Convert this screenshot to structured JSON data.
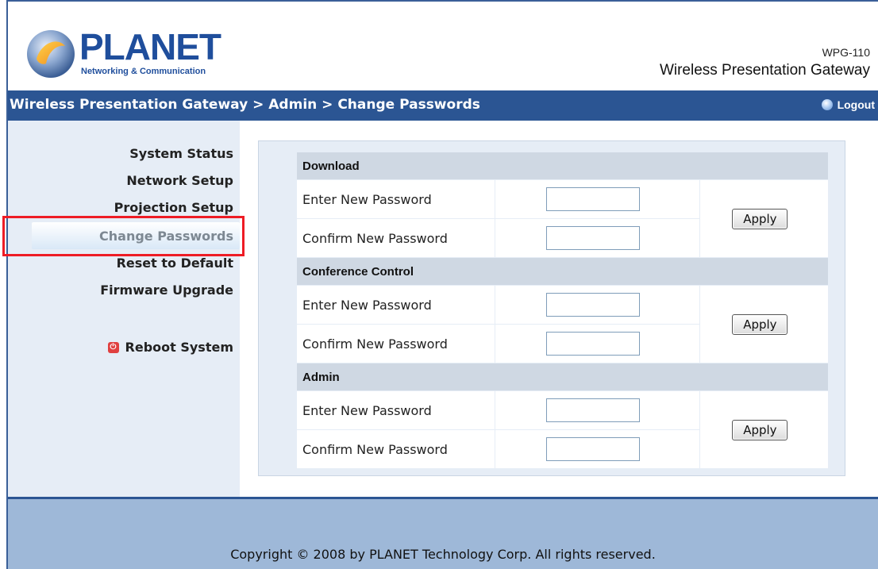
{
  "header": {
    "brand": "PLANET",
    "brand_tagline": "Networking & Communication",
    "model": "WPG-110",
    "product": "Wireless Presentation Gateway"
  },
  "titlebar": {
    "breadcrumb": "Wireless Presentation Gateway > Admin > Change Passwords",
    "logout_label": "Logout"
  },
  "sidebar": {
    "items": [
      {
        "label": "System Status"
      },
      {
        "label": "Network Setup"
      },
      {
        "label": "Projection Setup"
      },
      {
        "label": "Change Passwords",
        "active": true
      },
      {
        "label": "Reset to Default"
      },
      {
        "label": "Firmware Upgrade"
      }
    ],
    "reboot_label": "Reboot System"
  },
  "sections": [
    {
      "title": "Download",
      "enter_label": "Enter New Password",
      "confirm_label": "Confirm New Password",
      "apply_label": "Apply"
    },
    {
      "title": "Conference Control",
      "enter_label": "Enter New Password",
      "confirm_label": "Confirm New Password",
      "apply_label": "Apply"
    },
    {
      "title": "Admin",
      "enter_label": "Enter New Password",
      "confirm_label": "Confirm New Password",
      "apply_label": "Apply"
    }
  ],
  "footer": {
    "copyright": "Copyright © 2008 by PLANET Technology Corp. All rights reserved."
  },
  "colors": {
    "titlebar": "#2b5593",
    "sidebar_bg": "#e6edf6",
    "highlight": "#ee1c25",
    "footer_bg": "#9eb8d8"
  }
}
